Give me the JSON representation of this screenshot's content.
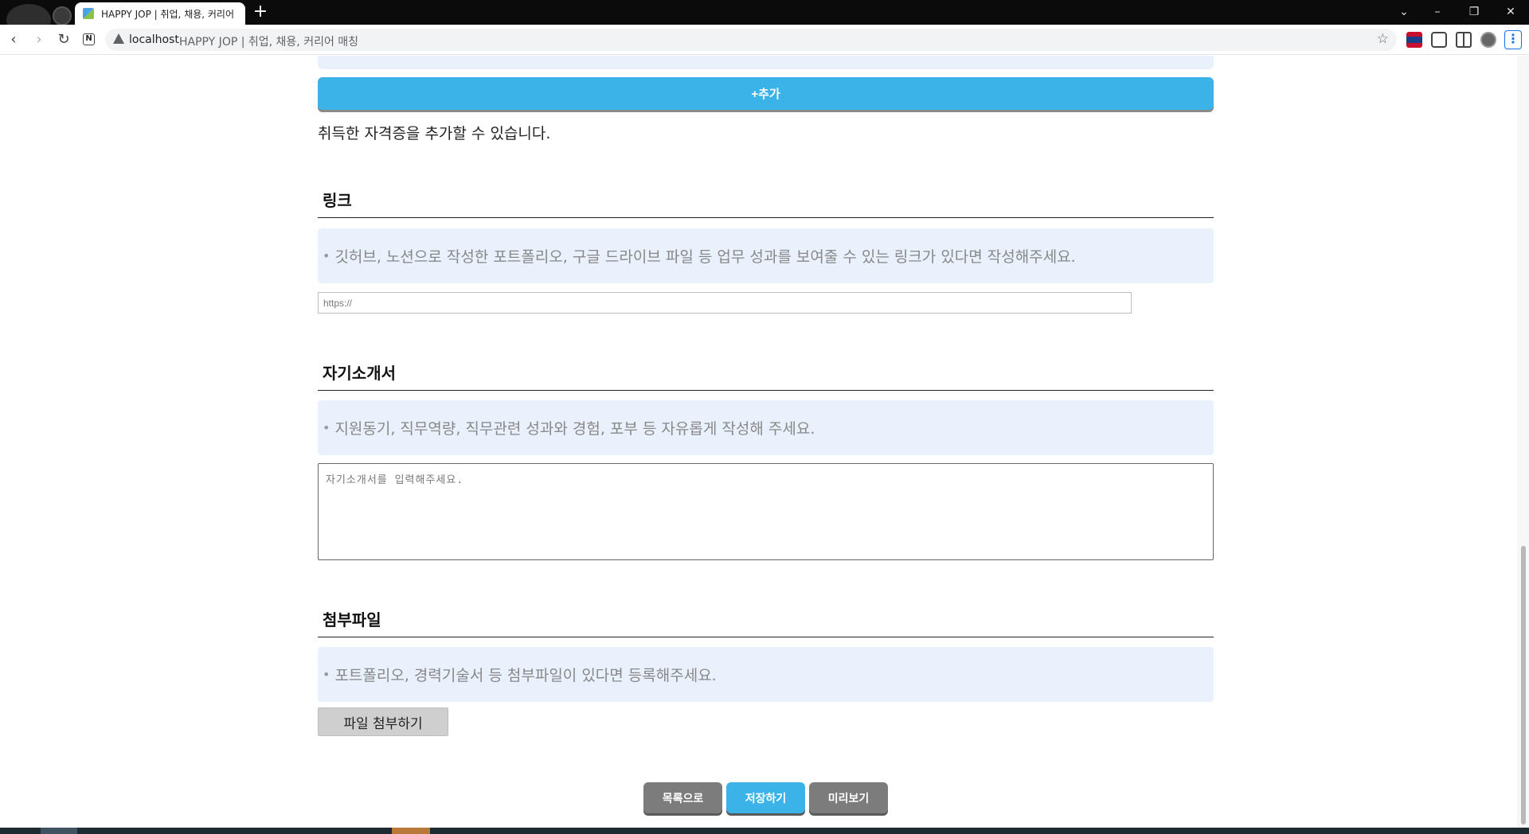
{
  "browser": {
    "tab_title": "HAPPY JOP | 취업, 채용, 커리어",
    "new_tab_symbol": "+",
    "address_host": "localhost",
    "address_title": "HAPPY JOP | 취업, 채용, 커리어 매칭",
    "window_controls": [
      "⌄",
      "–",
      "❐",
      "✕"
    ]
  },
  "certificate": {
    "add_button_label": "+추가",
    "note": "취득한 자격증을 추가할 수 있습니다."
  },
  "link_section": {
    "title": "링크",
    "guide": "깃허브, 노션으로 작성한 포트폴리오, 구글 드라이브 파일 등 업무 성과를 보여줄 수 있는 링크가 있다면 작성해주세요.",
    "placeholder": "https://"
  },
  "intro_section": {
    "title": "자기소개서",
    "guide": "지원동기, 직무역량, 직무관련 성과와 경험, 포부 등 자유롭게 작성해 주세요.",
    "placeholder": "자기소개서를 입력해주세요."
  },
  "attachment_section": {
    "title": "첨부파일",
    "guide": "포트폴리오, 경력기술서 등 첨부파일이 있다면 등록해주세요.",
    "upload_button": "파일 첨부하기"
  },
  "actions": {
    "list_button": "목록으로",
    "save_button": "저장하기",
    "preview_button": "미리보기"
  },
  "colors": {
    "accent_blue": "#3bb3e8",
    "guide_bg": "#e9f1fc",
    "gray_button": "#7c7c7c"
  }
}
